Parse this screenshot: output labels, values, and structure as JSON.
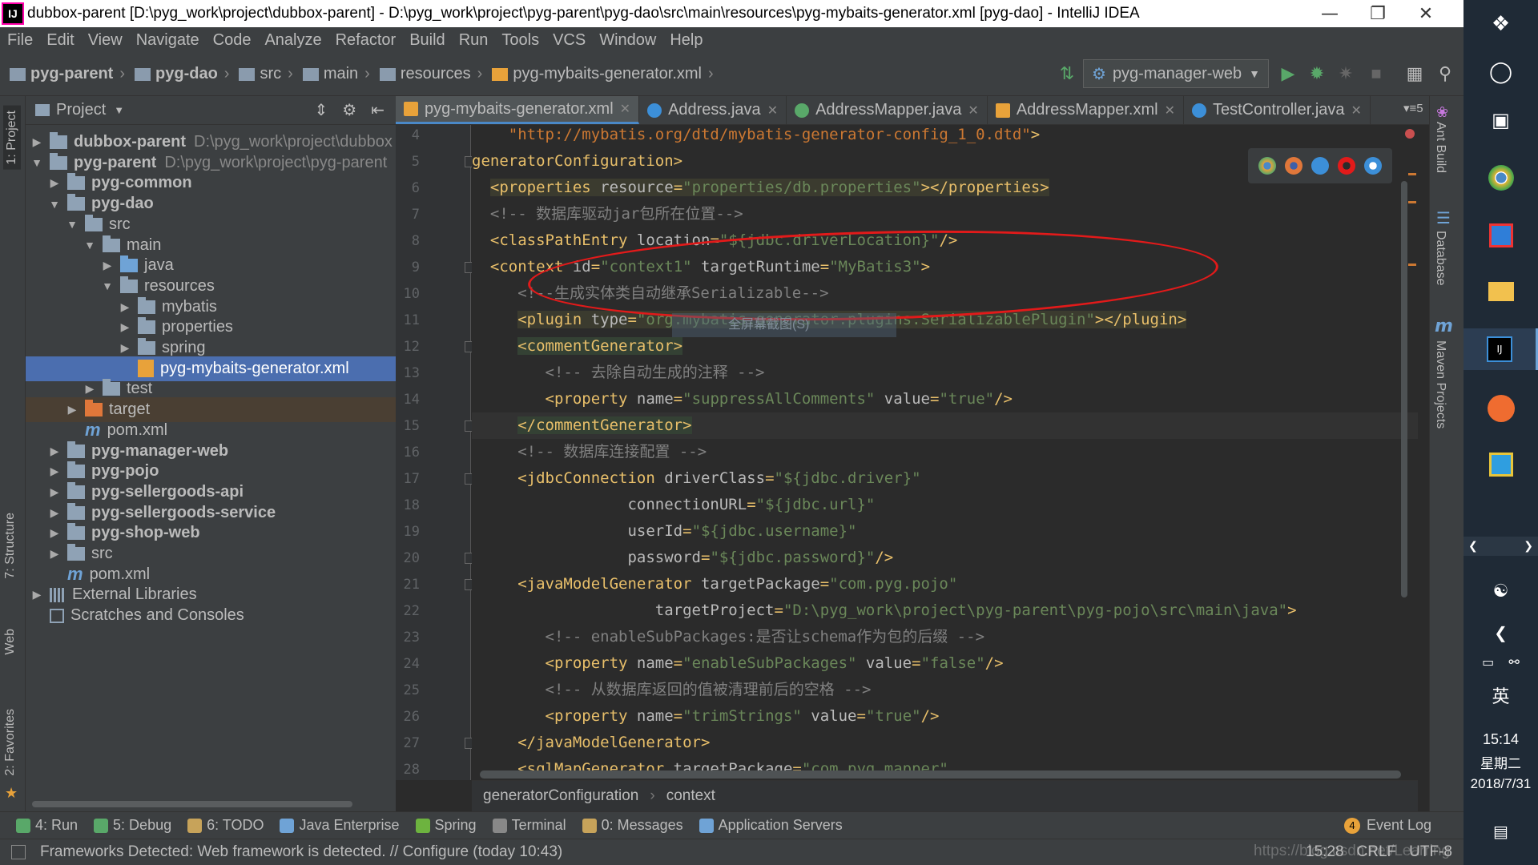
{
  "window": {
    "title": "dubbox-parent [D:\\pyg_work\\project\\dubbox-parent] - D:\\pyg_work\\project\\pyg-parent\\pyg-dao\\src\\main\\resources\\pyg-mybaits-generator.xml [pyg-dao] - IntelliJ IDEA",
    "app_icon": "IJ"
  },
  "menu": [
    "File",
    "Edit",
    "View",
    "Navigate",
    "Code",
    "Analyze",
    "Refactor",
    "Build",
    "Run",
    "Tools",
    "VCS",
    "Window",
    "Help"
  ],
  "nav_breadcrumb": [
    "pyg-parent",
    "pyg-dao",
    "src",
    "main",
    "resources",
    "pyg-mybaits-generator.xml"
  ],
  "run_config": "pyg-manager-web",
  "project_panel": {
    "title": "Project",
    "tree": [
      {
        "depth": 0,
        "arrow": "right",
        "icon": "module-folder",
        "label": "dubbox-parent",
        "path": "D:\\pyg_work\\project\\dubbox",
        "bold": true
      },
      {
        "depth": 0,
        "arrow": "down",
        "icon": "module-folder",
        "label": "pyg-parent",
        "path": "D:\\pyg_work\\project\\pyg-parent",
        "bold": true
      },
      {
        "depth": 1,
        "arrow": "right",
        "icon": "module-folder",
        "label": "pyg-common",
        "bold": true
      },
      {
        "depth": 1,
        "arrow": "down",
        "icon": "module-folder",
        "label": "pyg-dao",
        "bold": true
      },
      {
        "depth": 2,
        "arrow": "down",
        "icon": "folder",
        "label": "src"
      },
      {
        "depth": 3,
        "arrow": "down",
        "icon": "folder",
        "label": "main"
      },
      {
        "depth": 4,
        "arrow": "right",
        "icon": "folder-blue",
        "label": "java"
      },
      {
        "depth": 4,
        "arrow": "down",
        "icon": "folder",
        "label": "resources"
      },
      {
        "depth": 5,
        "arrow": "right",
        "icon": "folder",
        "label": "mybatis"
      },
      {
        "depth": 5,
        "arrow": "right",
        "icon": "folder",
        "label": "properties"
      },
      {
        "depth": 5,
        "arrow": "right",
        "icon": "folder",
        "label": "spring"
      },
      {
        "depth": 5,
        "arrow": "none",
        "icon": "xml",
        "label": "pyg-mybaits-generator.xml",
        "selected": true
      },
      {
        "depth": 3,
        "arrow": "right",
        "icon": "folder",
        "label": "test"
      },
      {
        "depth": 2,
        "arrow": "right",
        "icon": "folder-orange",
        "label": "target",
        "highlight": true
      },
      {
        "depth": 2,
        "arrow": "none",
        "icon": "maven",
        "label": "pom.xml"
      },
      {
        "depth": 1,
        "arrow": "right",
        "icon": "module-folder",
        "label": "pyg-manager-web",
        "bold": true
      },
      {
        "depth": 1,
        "arrow": "right",
        "icon": "module-folder",
        "label": "pyg-pojo",
        "bold": true
      },
      {
        "depth": 1,
        "arrow": "right",
        "icon": "module-folder",
        "label": "pyg-sellergoods-api",
        "bold": true
      },
      {
        "depth": 1,
        "arrow": "right",
        "icon": "module-folder",
        "label": "pyg-sellergoods-service",
        "bold": true
      },
      {
        "depth": 1,
        "arrow": "right",
        "icon": "module-folder",
        "label": "pyg-shop-web",
        "bold": true
      },
      {
        "depth": 1,
        "arrow": "right",
        "icon": "folder",
        "label": "src"
      },
      {
        "depth": 1,
        "arrow": "none",
        "icon": "maven",
        "label": "pom.xml"
      },
      {
        "depth": 0,
        "arrow": "right",
        "icon": "libraries",
        "label": "External Libraries"
      },
      {
        "depth": 0,
        "arrow": "none",
        "icon": "scratches",
        "label": "Scratches and Consoles"
      }
    ]
  },
  "left_tool_tabs": [
    "1: Project",
    "7: Structure",
    "Web",
    "2: Favorites"
  ],
  "right_tool_tabs": [
    "Ant Build",
    "Database",
    "Maven Projects"
  ],
  "editor_tabs": [
    {
      "label": "pyg-mybaits-generator.xml",
      "icon": "xml",
      "active": true
    },
    {
      "label": "Address.java",
      "icon": "class"
    },
    {
      "label": "AddressMapper.java",
      "icon": "interface"
    },
    {
      "label": "AddressMapper.xml",
      "icon": "xml"
    },
    {
      "label": "TestController.java",
      "icon": "class"
    }
  ],
  "tabs_overflow": "5",
  "code_lines": [
    {
      "n": "4",
      "indent": 4,
      "parts": [
        [
          "url",
          "\"http://mybatis.org/dtd/mybatis-generator-config_1_0.dtd\""
        ],
        [
          "tag",
          ">"
        ]
      ]
    },
    {
      "n": "5",
      "indent": 0,
      "parts": [
        [
          "tag",
          "generatorConfiguration>"
        ]
      ]
    },
    {
      "n": "6",
      "indent": 2,
      "hl": true,
      "parts": [
        [
          "tag",
          "<properties "
        ],
        [
          "attr",
          "resource"
        ],
        [
          "tag",
          "="
        ],
        [
          "val",
          "\"properties/db.properties\""
        ],
        [
          "tag",
          "></properties>"
        ]
      ]
    },
    {
      "n": "7",
      "indent": 2,
      "parts": [
        [
          "cmt",
          "<!-- 数据库驱动jar包所在位置-->"
        ]
      ]
    },
    {
      "n": "8",
      "indent": 2,
      "parts": [
        [
          "tag",
          "<classPathEntry "
        ],
        [
          "attr",
          "location"
        ],
        [
          "tag",
          "="
        ],
        [
          "val",
          "\"${jdbc.driverLocation}\""
        ],
        [
          "tag",
          "/>"
        ]
      ]
    },
    {
      "n": "9",
      "indent": 2,
      "parts": [
        [
          "tag",
          "<context "
        ],
        [
          "attr",
          "id"
        ],
        [
          "tag",
          "="
        ],
        [
          "val",
          "\"context1\" "
        ],
        [
          "attr",
          "targetRuntime"
        ],
        [
          "tag",
          "="
        ],
        [
          "val",
          "\"MyBatis3\""
        ],
        [
          "tag",
          ">"
        ]
      ]
    },
    {
      "n": "10",
      "indent": 5,
      "parts": [
        [
          "cmt",
          "<!--生成实体类自动继承Serializable-->"
        ]
      ]
    },
    {
      "n": "11",
      "indent": 5,
      "hl": true,
      "parts": [
        [
          "tag",
          "<plugin "
        ],
        [
          "attr",
          "type"
        ],
        [
          "tag",
          "="
        ],
        [
          "val",
          "\"org.mybatis.generator.plugins.SerializablePlugin\""
        ],
        [
          "tag",
          "></plugin>"
        ]
      ]
    },
    {
      "n": "12",
      "indent": 5,
      "hl2": true,
      "parts": [
        [
          "tag",
          "<commentGenerator>"
        ]
      ]
    },
    {
      "n": "13",
      "indent": 8,
      "parts": [
        [
          "cmt",
          "<!-- 去除自动生成的注释 -->"
        ]
      ]
    },
    {
      "n": "14",
      "indent": 8,
      "parts": [
        [
          "tag",
          "<property "
        ],
        [
          "attr",
          "name"
        ],
        [
          "tag",
          "="
        ],
        [
          "val",
          "\"suppressAllComments\" "
        ],
        [
          "attr",
          "value"
        ],
        [
          "tag",
          "="
        ],
        [
          "val",
          "\"true\""
        ],
        [
          "tag",
          "/>"
        ]
      ]
    },
    {
      "n": "15",
      "indent": 5,
      "cur": true,
      "hl2": true,
      "parts": [
        [
          "tag",
          "</commentGenerator>"
        ]
      ]
    },
    {
      "n": "16",
      "indent": 5,
      "parts": [
        [
          "cmt",
          "<!-- 数据库连接配置 -->"
        ]
      ]
    },
    {
      "n": "17",
      "indent": 5,
      "parts": [
        [
          "tag",
          "<jdbcConnection "
        ],
        [
          "attr",
          "driverClass"
        ],
        [
          "tag",
          "="
        ],
        [
          "val",
          "\"${jdbc.driver}\""
        ]
      ]
    },
    {
      "n": "18",
      "indent": 17,
      "parts": [
        [
          "attr",
          "connectionURL"
        ],
        [
          "tag",
          "="
        ],
        [
          "val",
          "\"${jdbc.url}\""
        ]
      ]
    },
    {
      "n": "19",
      "indent": 17,
      "parts": [
        [
          "attr",
          "userId"
        ],
        [
          "tag",
          "="
        ],
        [
          "val",
          "\"${jdbc.username}\""
        ]
      ]
    },
    {
      "n": "20",
      "indent": 17,
      "parts": [
        [
          "attr",
          "password"
        ],
        [
          "tag",
          "="
        ],
        [
          "val",
          "\"${jdbc.password}\""
        ],
        [
          "tag",
          "/>"
        ]
      ]
    },
    {
      "n": "21",
      "indent": 5,
      "parts": [
        [
          "tag",
          "<javaModelGenerator "
        ],
        [
          "attr",
          "targetPackage"
        ],
        [
          "tag",
          "="
        ],
        [
          "val",
          "\"com.pyg.pojo\""
        ]
      ]
    },
    {
      "n": "22",
      "indent": 20,
      "parts": [
        [
          "attr",
          "targetProject"
        ],
        [
          "tag",
          "="
        ],
        [
          "val",
          "\"D:\\pyg_work\\project\\pyg-parent\\pyg-pojo\\src\\main\\java\""
        ],
        [
          "tag",
          ">"
        ]
      ]
    },
    {
      "n": "23",
      "indent": 8,
      "parts": [
        [
          "cmt",
          "<!-- enableSubPackages:是否让schema作为包的后缀 -->"
        ]
      ]
    },
    {
      "n": "24",
      "indent": 8,
      "parts": [
        [
          "tag",
          "<property "
        ],
        [
          "attr",
          "name"
        ],
        [
          "tag",
          "="
        ],
        [
          "val",
          "\"enableSubPackages\" "
        ],
        [
          "attr",
          "value"
        ],
        [
          "tag",
          "="
        ],
        [
          "val",
          "\"false\""
        ],
        [
          "tag",
          "/>"
        ]
      ]
    },
    {
      "n": "25",
      "indent": 8,
      "parts": [
        [
          "cmt",
          "<!-- 从数据库返回的值被清理前后的空格 -->"
        ]
      ]
    },
    {
      "n": "26",
      "indent": 8,
      "parts": [
        [
          "tag",
          "<property "
        ],
        [
          "attr",
          "name"
        ],
        [
          "tag",
          "="
        ],
        [
          "val",
          "\"trimStrings\" "
        ],
        [
          "attr",
          "value"
        ],
        [
          "tag",
          "="
        ],
        [
          "val",
          "\"true\""
        ],
        [
          "tag",
          "/>"
        ]
      ]
    },
    {
      "n": "27",
      "indent": 5,
      "parts": [
        [
          "tag",
          "</javaModelGenerator>"
        ]
      ]
    },
    {
      "n": "28",
      "indent": 5,
      "parts": [
        [
          "tag",
          "<sqlMapGenerator "
        ],
        [
          "attr",
          "targetPackage"
        ],
        [
          "tag",
          "="
        ],
        [
          "val",
          "\"com.pyg.mapper\""
        ]
      ]
    }
  ],
  "editor_breadcrumb": [
    "generatorConfiguration",
    "context"
  ],
  "bottom_tools": [
    {
      "label": "4: Run",
      "color": "#59a869"
    },
    {
      "label": "5: Debug",
      "color": "#59a869"
    },
    {
      "label": "6: TODO",
      "color": "#c7a35a"
    },
    {
      "label": "Java Enterprise",
      "color": "#6fa3d6"
    },
    {
      "label": "Spring",
      "color": "#6db33f"
    },
    {
      "label": "Terminal",
      "color": "#888888"
    },
    {
      "label": "0: Messages",
      "color": "#c7a35a"
    },
    {
      "label": "Application Servers",
      "color": "#6fa3d6"
    }
  ],
  "event_log": {
    "count": "4",
    "label": "Event Log"
  },
  "status": {
    "message": "Frameworks Detected: Web framework is detected. // Configure (today 10:43)",
    "position": "15:28",
    "line_sep": "CRLF",
    "encoding": "UTF-8",
    "watermark": "https://blog.csdn.net/Learring"
  },
  "taskbar": {
    "time": "15:14",
    "weekday": "星期二",
    "date": "2018/7/31",
    "ime": "英"
  },
  "overlay_tip": "全屏幕截图(S)",
  "colors": {
    "accent": "#4a88c7",
    "selection": "#4b6eaf",
    "annotation": "#e21a1a"
  }
}
